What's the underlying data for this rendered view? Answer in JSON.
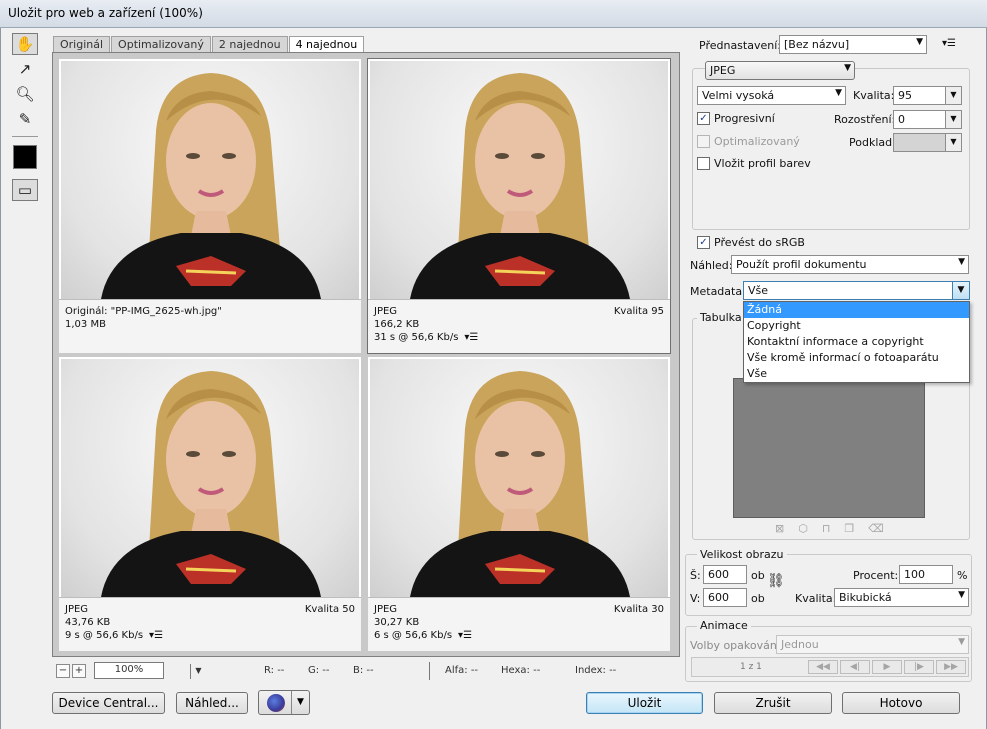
{
  "window": {
    "title": "Uložit pro web a zařízení (100%)"
  },
  "tabs": [
    "Originál",
    "Optimalizovaný",
    "2 najednou",
    "4 najednou"
  ],
  "panes": [
    {
      "line1": "Originál: \"PP-IMG_2625-wh.jpg\"",
      "line2": "1,03 MB",
      "line3": "",
      "quality": ""
    },
    {
      "line1": "JPEG",
      "line2": "166,2 KB",
      "line3": "31 s @ 56,6 Kb/s",
      "quality": "Kvalita 95"
    },
    {
      "line1": "JPEG",
      "line2": "43,76 KB",
      "line3": "9 s @ 56,6 Kb/s",
      "quality": "Kvalita 50"
    },
    {
      "line1": "JPEG",
      "line2": "30,27 KB",
      "line3": "6 s @ 56,6 Kb/s",
      "quality": "Kvalita 30"
    }
  ],
  "zoom": {
    "value": "100%",
    "minus": "−",
    "plus": "+"
  },
  "readouts": {
    "r": "R: --",
    "g": "G: --",
    "b": "B: --",
    "alpha": "Alfa: --",
    "hex": "Hexa: --",
    "index": "Index: --"
  },
  "buttons": {
    "device_central": "Device Central...",
    "preview": "Náhled...",
    "save": "Uložit",
    "cancel": "Zrušit",
    "done": "Hotovo"
  },
  "settings": {
    "preset_label": "Přednastavení:",
    "preset_value": "[Bez názvu]",
    "format": "JPEG",
    "quality_preset": "Velmi vysoká",
    "quality_label": "Kvalita:",
    "quality_value": "95",
    "progressive": "Progresivní",
    "blur_label": "Rozostření:",
    "blur_value": "0",
    "optimized": "Optimalizovaný",
    "matte_label": "Podklad:",
    "embed_profile": "Vložit profil barev",
    "convert_srgb": "Převést do sRGB",
    "preview_label": "Náhled:",
    "preview_value": "Použít profil dokumentu",
    "metadata_label": "Metadata:",
    "metadata_value": "Vše",
    "color_table_label": "Tabulka b"
  },
  "metadata_options": [
    "Žádná",
    "Copyright",
    "Kontaktní informace a copyright",
    "Vše kromě informací o fotoaparátu",
    "Vše"
  ],
  "image_size": {
    "title": "Velikost obrazu",
    "w_label": "Š:",
    "w_value": "600",
    "w_unit": "ob",
    "h_label": "V:",
    "h_value": "600",
    "h_unit": "ob",
    "percent_label": "Procent:",
    "percent_value": "100",
    "percent_unit": "%",
    "quality_label": "Kvalita:",
    "quality_value": "Bikubická"
  },
  "animation": {
    "title": "Animace",
    "loop_label": "Volby opakování:",
    "loop_value": "Jednou",
    "frame": "1 z 1"
  }
}
